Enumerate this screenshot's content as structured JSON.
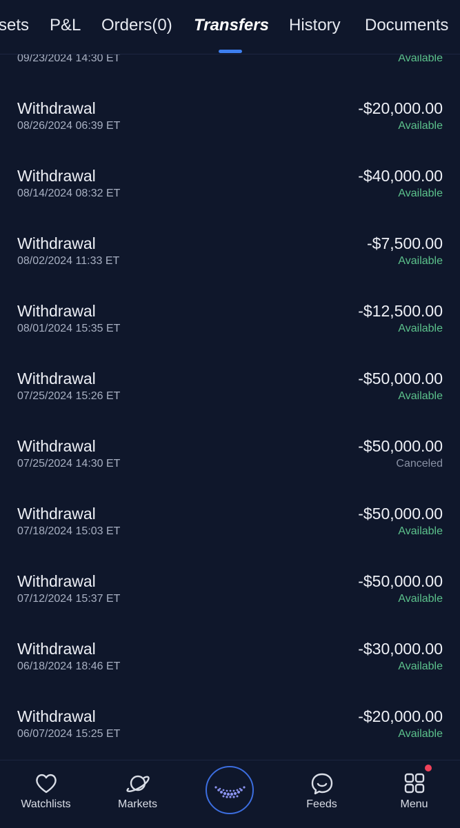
{
  "tabs": [
    {
      "label": "sets"
    },
    {
      "label": "P&L"
    },
    {
      "label": "Orders(0)"
    },
    {
      "label": "Transfers"
    },
    {
      "label": "History"
    },
    {
      "label": "Documents"
    }
  ],
  "active_tab": "Transfers",
  "transfers": [
    {
      "type": "",
      "date": "09/23/2024 14:30 ET",
      "amount": "",
      "status": "Available"
    },
    {
      "type": "Withdrawal",
      "date": "08/26/2024 06:39 ET",
      "amount": "-$20,000.00",
      "status": "Available"
    },
    {
      "type": "Withdrawal",
      "date": "08/14/2024 08:32 ET",
      "amount": "-$40,000.00",
      "status": "Available"
    },
    {
      "type": "Withdrawal",
      "date": "08/02/2024 11:33 ET",
      "amount": "-$7,500.00",
      "status": "Available"
    },
    {
      "type": "Withdrawal",
      "date": "08/01/2024 15:35 ET",
      "amount": "-$12,500.00",
      "status": "Available"
    },
    {
      "type": "Withdrawal",
      "date": "07/25/2024 15:26 ET",
      "amount": "-$50,000.00",
      "status": "Available"
    },
    {
      "type": "Withdrawal",
      "date": "07/25/2024 14:30 ET",
      "amount": "-$50,000.00",
      "status": "Canceled"
    },
    {
      "type": "Withdrawal",
      "date": "07/18/2024 15:03 ET",
      "amount": "-$50,000.00",
      "status": "Available"
    },
    {
      "type": "Withdrawal",
      "date": "07/12/2024 15:37 ET",
      "amount": "-$50,000.00",
      "status": "Available"
    },
    {
      "type": "Withdrawal",
      "date": "06/18/2024 18:46 ET",
      "amount": "-$30,000.00",
      "status": "Available"
    },
    {
      "type": "Withdrawal",
      "date": "06/07/2024 15:25 ET",
      "amount": "-$20,000.00",
      "status": "Available"
    }
  ],
  "bottom_nav": [
    {
      "label": "Watchlists",
      "icon": "heart-icon"
    },
    {
      "label": "Markets",
      "icon": "planet-icon"
    },
    {
      "label": "",
      "icon": "center-logo-icon"
    },
    {
      "label": "Feeds",
      "icon": "chat-smile-icon"
    },
    {
      "label": "Menu",
      "icon": "grid-icon"
    }
  ],
  "colors": {
    "background": "#0f172b",
    "available": "#5cc28c",
    "canceled": "#8a92a5",
    "accent": "#3d7ff0",
    "notification": "#f0425a"
  }
}
